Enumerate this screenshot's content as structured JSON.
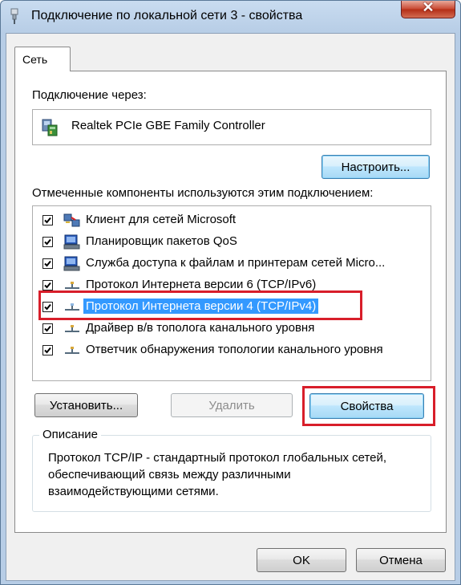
{
  "window": {
    "title": "Подключение по локальной сети 3 - свойства",
    "close_label": "✕",
    "title_icon": "network-plug-icon"
  },
  "tabs": [
    {
      "label": "Сеть",
      "active": true
    }
  ],
  "connect_via": {
    "label": "Подключение через:",
    "adapter_name": "Realtek PCIe GBE Family Controller",
    "adapter_icon": "network-adapter-icon",
    "configure_button": "Настроить..."
  },
  "components": {
    "label": "Отмеченные компоненты используются этим подключением:",
    "items": [
      {
        "label": "Клиент для сетей Microsoft",
        "checked": true,
        "icon": "network-client-icon"
      },
      {
        "label": "Планировщик пакетов QoS",
        "checked": true,
        "icon": "network-service-icon"
      },
      {
        "label": "Служба доступа к файлам и принтерам сетей Micro...",
        "checked": true,
        "icon": "network-service-icon"
      },
      {
        "label": "Протокол Интернета версии 6 (TCP/IPv6)",
        "checked": true,
        "icon": "protocol-icon"
      },
      {
        "label": "Протокол Интернета версии 4 (TCP/IPv4)",
        "checked": true,
        "icon": "protocol-icon",
        "selected": true
      },
      {
        "label": "Драйвер в/в тополога канального уровня",
        "checked": true,
        "icon": "protocol-icon"
      },
      {
        "label": "Ответчик обнаружения топологии канального уровня",
        "checked": true,
        "icon": "protocol-icon"
      }
    ]
  },
  "actions": {
    "install": "Установить...",
    "remove": "Удалить",
    "properties": "Свойства"
  },
  "description": {
    "title": "Описание",
    "text": "Протокол TCP/IP - стандартный протокол глобальных сетей, обеспечивающий связь между различными взаимодействующими сетями."
  },
  "footer": {
    "ok": "OK",
    "cancel": "Отмена"
  },
  "colors": {
    "selection": "#3399ff",
    "highlight_box": "#d81e2a"
  }
}
